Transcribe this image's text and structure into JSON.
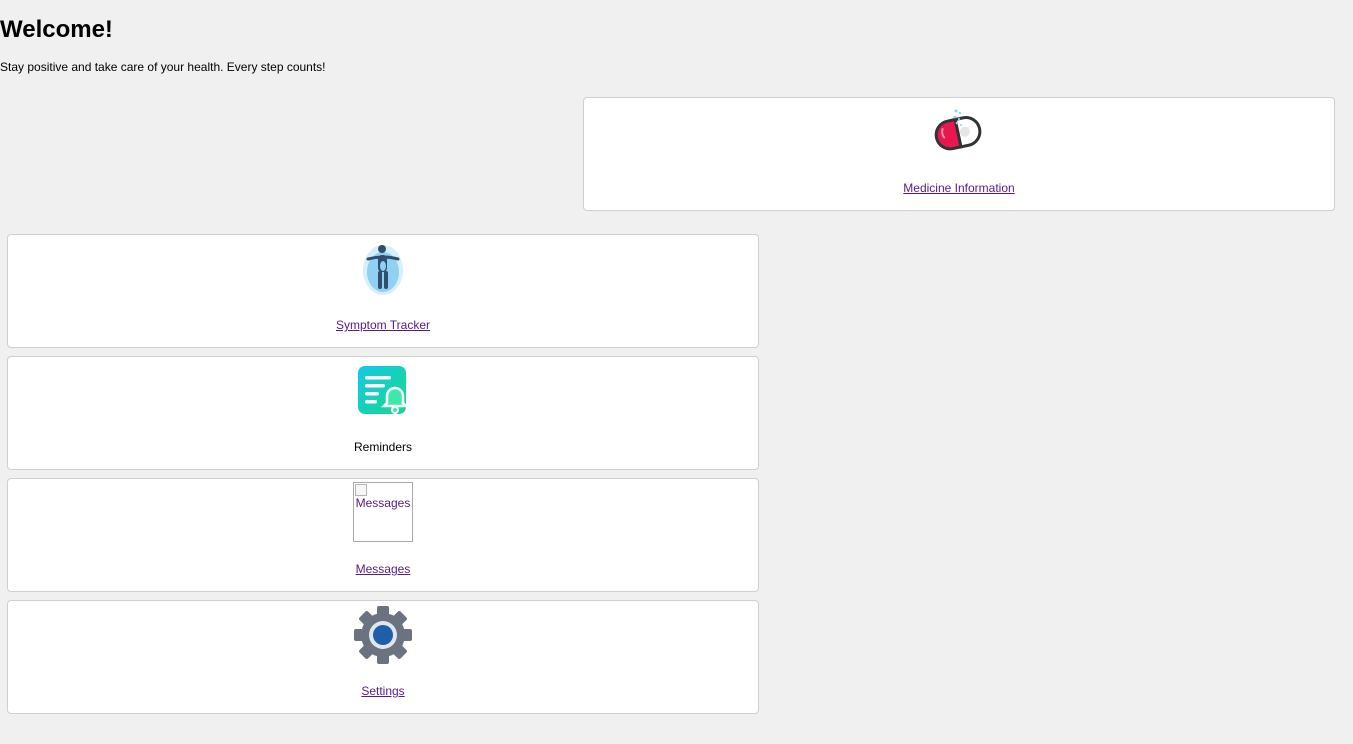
{
  "header": {
    "title": "Welcome!",
    "subtitle": "Stay positive and take care of your health. Every step counts!"
  },
  "cards": {
    "medicine": {
      "label": "Medicine Information",
      "icon": "pill-capsule-icon"
    },
    "symptom": {
      "label": "Symptom Tracker",
      "icon": "person-body-icon"
    },
    "reminders": {
      "label": "Reminders",
      "icon": "bell-list-icon"
    },
    "messages": {
      "label": "Messages",
      "image_alt": "Messages",
      "icon": "broken-image-icon"
    },
    "settings": {
      "label": "Settings",
      "icon": "gear-icon"
    }
  },
  "colors": {
    "background": "#f0f0f0",
    "card": "#ffffff",
    "link": "#551a8b",
    "pill_red": "#e8174f",
    "reminder_gradient_start": "#16c8e6",
    "reminder_gradient_end": "#18d98a",
    "gear_gray": "#6b7380",
    "gear_center": "#1f5fa8"
  }
}
